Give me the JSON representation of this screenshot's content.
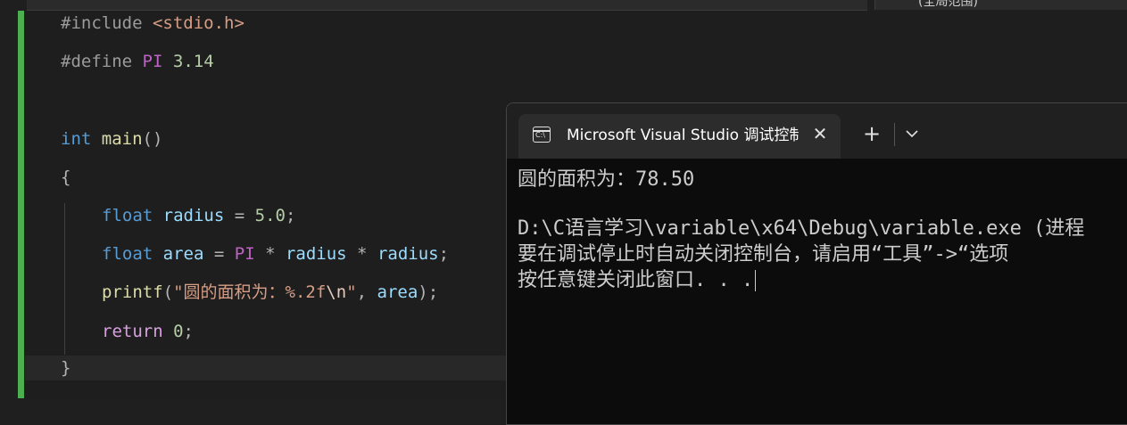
{
  "top_tabs": {
    "right_tab_partial": "(全局范围)"
  },
  "editor": {
    "lines": [
      {
        "pre_kw": "#include",
        "header": "<stdio.h>"
      },
      {
        "pre_kw": "#define",
        "macro": "PI",
        "value": "3.14"
      },
      {
        "type": "int",
        "name": "main",
        "parens": "()"
      },
      {
        "brace_open": "{"
      },
      {
        "type": "float",
        "var": "radius",
        "op": " = ",
        "value": "5.0",
        "end": ";"
      },
      {
        "type": "float",
        "var": "area",
        "op": " = ",
        "macro": "PI",
        "mul1": " * ",
        "v1": "radius",
        "mul2": " * ",
        "v2": "radius",
        "end": ";"
      },
      {
        "fn": "printf",
        "open": "(",
        "str_start": "\"圆的面积为：%.2f",
        "esc": "\\n",
        "str_end": "\"",
        "comma": ", ",
        "arg": "area",
        "close": ");"
      },
      {
        "kw": "return",
        "value": "0",
        "end": ";"
      },
      {
        "brace_close": "}"
      }
    ]
  },
  "terminal": {
    "tab_title": "Microsoft Visual Studio 调试控制台",
    "icons": {
      "tab": "console-icon",
      "close": "close-icon",
      "new_tab": "plus-icon",
      "dropdown": "chevron-down-icon"
    },
    "close_glyph": "✕",
    "new_tab_glyph": "+",
    "icon_text": "C:\\",
    "output": [
      "圆的面积为：78.50",
      "",
      "D:\\C语言学习\\variable\\x64\\Debug\\variable.exe (进程",
      "要在调试停止时自动关闭控制台，请启用“工具”->“选项",
      "按任意键关闭此窗口. . ."
    ]
  },
  "colors": {
    "change_bar": "#4caf50",
    "keyword": "#569cd6",
    "string": "#d69d85",
    "macro": "#bd63c5"
  }
}
